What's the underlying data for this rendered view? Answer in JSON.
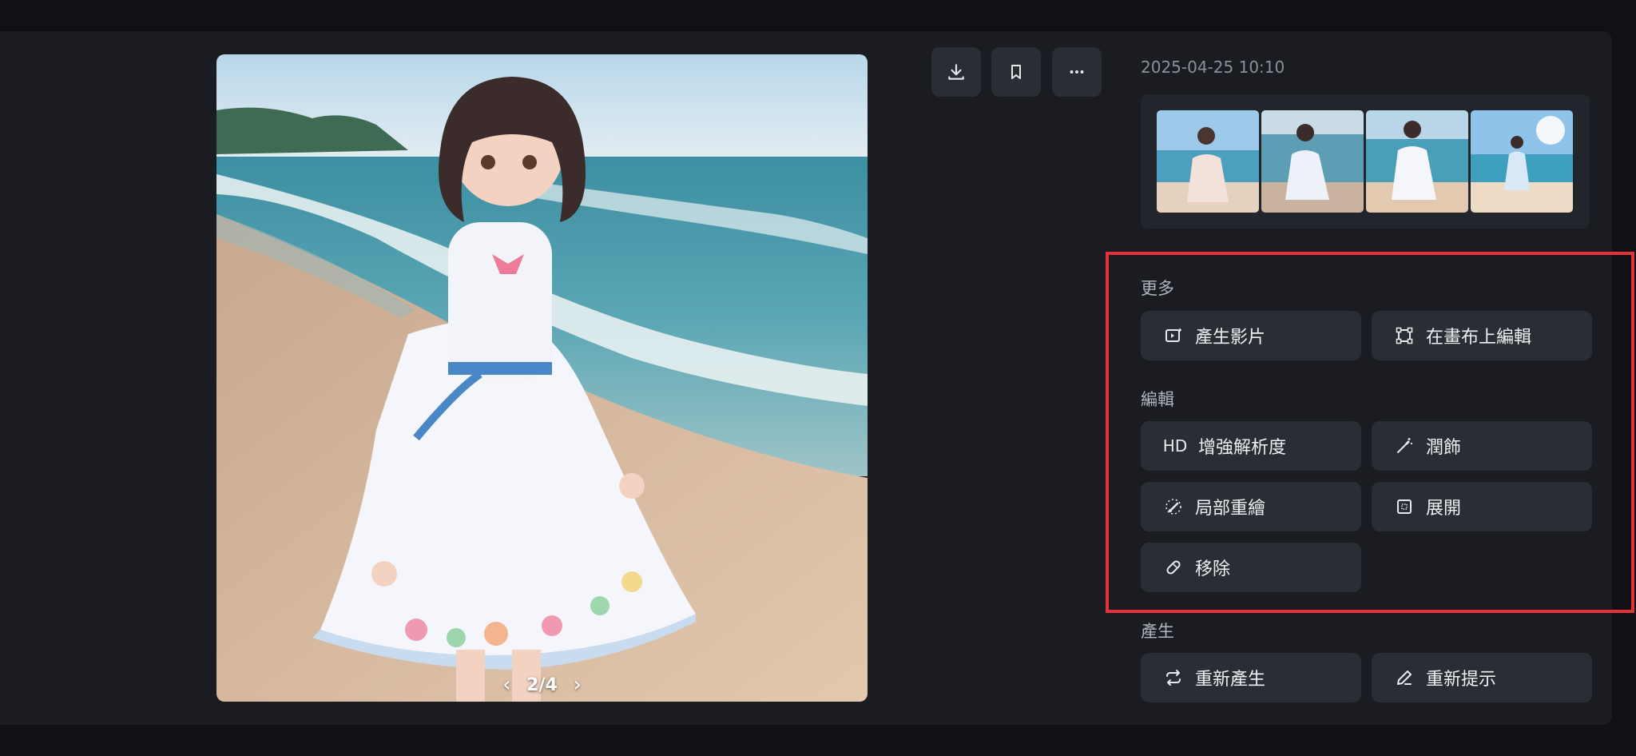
{
  "image_viewer": {
    "pager": {
      "current": "2/4",
      "prev_icon": "chevron-left-icon",
      "next_icon": "chevron-right-icon"
    },
    "toolbar": {
      "download_icon": "download-icon",
      "bookmark_icon": "bookmark-icon",
      "more_icon": "more-horizontal-icon"
    }
  },
  "sidebar": {
    "timestamp": "2025-04-25 10:10",
    "sections": {
      "more": {
        "title": "更多",
        "buttons": [
          {
            "label": "產生影片",
            "icon": "video-generate-icon"
          },
          {
            "label": "在畫布上編輯",
            "icon": "canvas-edit-icon"
          }
        ]
      },
      "edit": {
        "title": "編輯",
        "buttons": [
          {
            "label": "增強解析度",
            "icon_text": "HD"
          },
          {
            "label": "潤飾",
            "icon": "magic-wand-icon"
          },
          {
            "label": "局部重繪",
            "icon": "inpaint-brush-icon"
          },
          {
            "label": "展開",
            "icon": "expand-icon"
          },
          {
            "label": "移除",
            "icon": "eraser-icon"
          }
        ]
      },
      "generate": {
        "title": "產生",
        "buttons": [
          {
            "label": "重新產生",
            "icon": "regenerate-icon"
          },
          {
            "label": "重新提示",
            "icon": "pencil-icon"
          }
        ]
      }
    }
  },
  "colors": {
    "background": "#0f1114",
    "panel": "#1a1c21",
    "button": "#2a2d33",
    "highlight_border": "#e5323b"
  }
}
